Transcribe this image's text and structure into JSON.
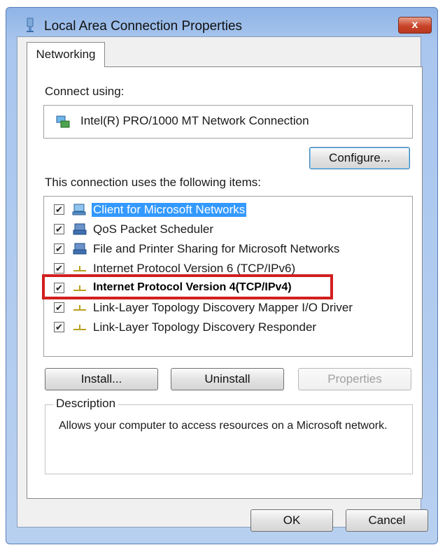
{
  "window": {
    "title": "Local Area Connection Properties",
    "close_label": "x"
  },
  "tabs": [
    {
      "label": "Networking",
      "active": true
    }
  ],
  "connect_using": {
    "label": "Connect using:",
    "adapter": "Intel(R) PRO/1000 MT Network Connection",
    "configure_label": "Configure..."
  },
  "items_section": {
    "label": "This connection uses the following items:",
    "items": [
      {
        "label": "Client for Microsoft Networks",
        "checked": true,
        "selected": true,
        "icon": "network-client-icon"
      },
      {
        "label": "QoS Packet Scheduler",
        "checked": true,
        "selected": false,
        "icon": "service-icon"
      },
      {
        "label": "File and Printer Sharing for Microsoft Networks",
        "checked": true,
        "selected": false,
        "icon": "service-icon"
      },
      {
        "label": "Internet Protocol Version 6 (TCP/IPv6)",
        "checked": true,
        "selected": false,
        "icon": "protocol-icon"
      },
      {
        "label": "Internet Protocol Version 4(TCP/IPv4)",
        "checked": true,
        "selected": false,
        "icon": "protocol-icon"
      },
      {
        "label": "Link-Layer Topology Discovery Mapper I/O Driver",
        "checked": true,
        "selected": false,
        "icon": "protocol-icon"
      },
      {
        "label": "Link-Layer Topology Discovery Responder",
        "checked": true,
        "selected": false,
        "icon": "protocol-icon"
      }
    ]
  },
  "item_buttons": {
    "install_label": "Install...",
    "uninstall_label": "Uninstall",
    "properties_label": "Properties"
  },
  "description": {
    "legend": "Description",
    "text": "Allows your computer to access resources on a Microsoft network."
  },
  "footer": {
    "ok_label": "OK",
    "cancel_label": "Cancel"
  },
  "colors": {
    "selection": "#3399ff",
    "highlight_annotation": "#d11f1f",
    "titlebar": "#a9c6ee"
  }
}
